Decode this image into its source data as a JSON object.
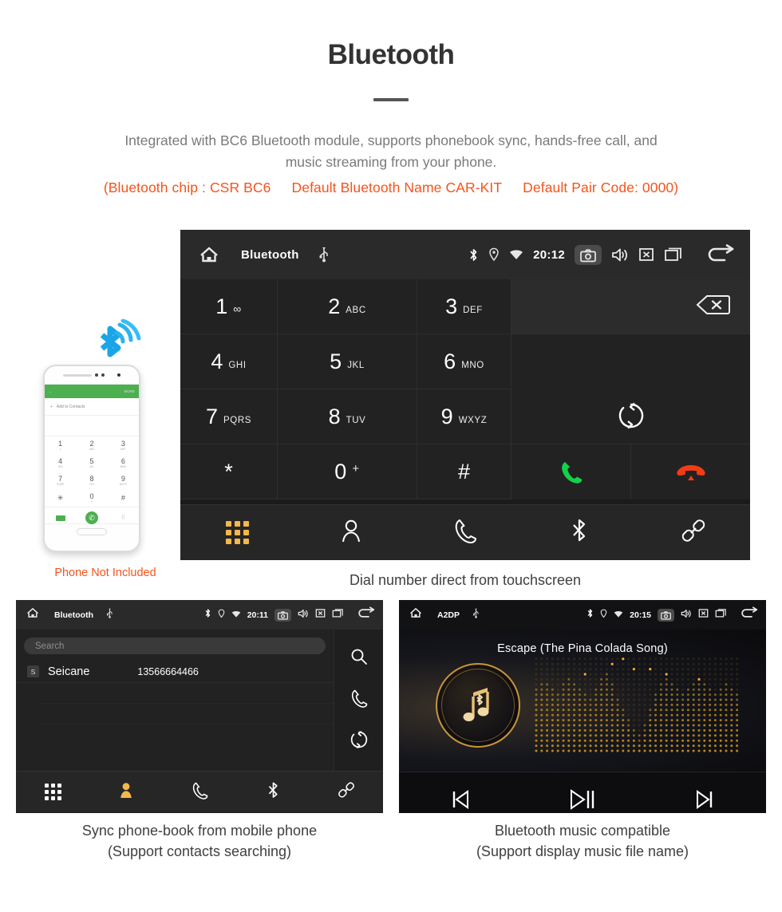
{
  "header": {
    "title": "Bluetooth",
    "intro_line1": "Integrated with BC6 Bluetooth module, supports phonebook sync, hands-free call, and",
    "intro_line2": "music streaming from your phone.",
    "spec_chip": "(Bluetooth chip : CSR BC6",
    "spec_name": "Default Bluetooth Name CAR-KIT",
    "spec_pair": "Default Pair Code: 0000)",
    "accent_color": "#f4541d",
    "text_color": "#7a7a7a"
  },
  "phone_mockup": {
    "note": "Phone Not Included",
    "screen": {
      "more_label": "MORE",
      "add_contacts": "Add to Contacts",
      "keys": [
        {
          "digit": "1",
          "letters": "∞"
        },
        {
          "digit": "2",
          "letters": "ABC"
        },
        {
          "digit": "3",
          "letters": "DEF"
        },
        {
          "digit": "4",
          "letters": "GHI"
        },
        {
          "digit": "5",
          "letters": "JKL"
        },
        {
          "digit": "6",
          "letters": "MNO"
        },
        {
          "digit": "7",
          "letters": "PQRS"
        },
        {
          "digit": "8",
          "letters": "TUV"
        },
        {
          "digit": "9",
          "letters": "WXYZ"
        },
        {
          "digit": "*",
          "letters": ""
        },
        {
          "digit": "0",
          "letters": "+"
        },
        {
          "digit": "#",
          "letters": ""
        }
      ]
    }
  },
  "dialer": {
    "statusbar": {
      "title": "Bluetooth",
      "time": "20:12",
      "icons": [
        "home-icon",
        "usb-icon",
        "bluetooth-icon",
        "location-icon",
        "wifi-icon",
        "camera-icon",
        "volume-icon",
        "close-box-icon",
        "recents-icon",
        "back-icon"
      ]
    },
    "keys": [
      {
        "digit": "1",
        "letters": "",
        "voicemail": true
      },
      {
        "digit": "2",
        "letters": "ABC"
      },
      {
        "digit": "3",
        "letters": "DEF"
      },
      {
        "digit": "4",
        "letters": "GHI"
      },
      {
        "digit": "5",
        "letters": "JKL"
      },
      {
        "digit": "6",
        "letters": "MNO"
      },
      {
        "digit": "7",
        "letters": "PQRS"
      },
      {
        "digit": "8",
        "letters": "TUV"
      },
      {
        "digit": "9",
        "letters": "WXYZ"
      },
      {
        "digit": "*",
        "letters": ""
      },
      {
        "digit": "0",
        "letters": "+"
      },
      {
        "digit": "#",
        "letters": ""
      }
    ],
    "input_value": "",
    "nav": [
      {
        "name": "dialpad",
        "active": true
      },
      {
        "name": "contacts",
        "active": false
      },
      {
        "name": "call-log",
        "active": false
      },
      {
        "name": "bluetooth",
        "active": false
      },
      {
        "name": "link",
        "active": false
      }
    ],
    "caption": "Dial number direct from touchscreen",
    "active_color": "#f3b84b",
    "call_color": "#14d14a",
    "hangup_color": "#f03c16"
  },
  "phonebook": {
    "statusbar": {
      "title": "Bluetooth",
      "time": "20:11"
    },
    "search_placeholder": "Search",
    "search_value": "",
    "contacts": [
      {
        "initial": "S",
        "name": "Seicane",
        "number": "13566664466"
      }
    ],
    "side_icons": [
      "search-icon",
      "call-icon",
      "sync-icon"
    ],
    "nav": [
      {
        "name": "dialpad",
        "active": false
      },
      {
        "name": "contacts",
        "active": true
      },
      {
        "name": "call-log",
        "active": false
      },
      {
        "name": "bluetooth",
        "active": false
      },
      {
        "name": "link",
        "active": false
      }
    ],
    "caption_line1": "Sync phone-book from mobile phone",
    "caption_line2": "(Support contacts searching)"
  },
  "music": {
    "statusbar": {
      "title": "A2DP",
      "time": "20:15"
    },
    "track_title": "Escape (The Pina Colada Song)",
    "controls": [
      "previous-track-button",
      "play-pause-button",
      "next-track-button"
    ],
    "caption_line1": "Bluetooth music compatible",
    "caption_line2": "(Support display music file name)",
    "gold_color": "#c9953a"
  }
}
